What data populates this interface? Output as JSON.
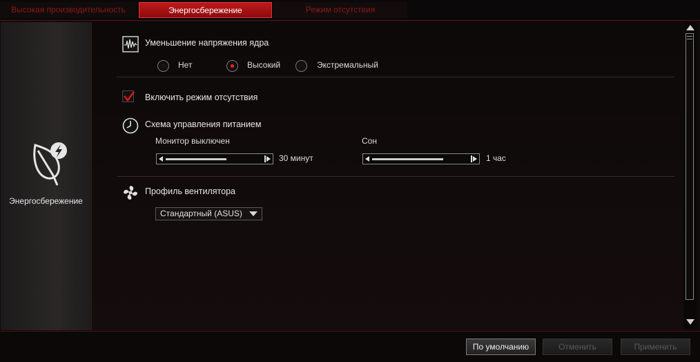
{
  "tabs": [
    {
      "label": "Высокая производительность",
      "active": false
    },
    {
      "label": "Энергосбережение",
      "active": true
    },
    {
      "label": "Режим отсутствия",
      "active": false
    }
  ],
  "left_panel": {
    "label": "Энергосбережение",
    "icon": "leaf-bolt-icon"
  },
  "core_voltage": {
    "title": "Уменьшение напряжения ядра",
    "icon": "waveform-icon",
    "options": [
      {
        "label": "Нет",
        "selected": false
      },
      {
        "label": "Высокий",
        "selected": true
      },
      {
        "label": "Экстремальный",
        "selected": false
      }
    ]
  },
  "away_mode": {
    "label": "Включить режим отсутствия",
    "checked": true
  },
  "power_scheme": {
    "title": "Схема управления питанием",
    "icon": "clock-icon",
    "monitor": {
      "label": "Монитор выключен",
      "value": "30 минут"
    },
    "sleep": {
      "label": "Сон",
      "value": "1 час"
    }
  },
  "fan_profile": {
    "title": "Профиль вентилятора",
    "icon": "fan-icon",
    "selected": "Стандартный (ASUS)"
  },
  "buttons": {
    "default": "По умолчанию",
    "cancel": "Отменить",
    "apply": "Применить"
  },
  "colors": {
    "accent": "#c0181a",
    "background": "#0f0b0b"
  }
}
